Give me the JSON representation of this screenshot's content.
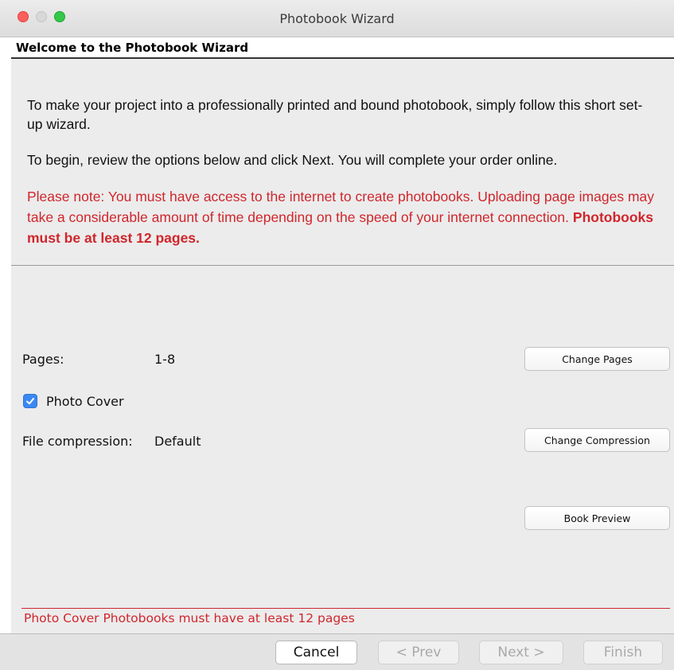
{
  "window": {
    "title": "Photobook Wizard"
  },
  "header": {
    "title": "Welcome to the Photobook Wizard"
  },
  "intro": {
    "paragraph1": "To make your project into a professionally printed and bound photobook, simply follow this short set-up wizard.",
    "paragraph2": "To begin, review the options below and click Next. You will complete your order online.",
    "note": "Please note: You must have access to the internet to create photobooks. Uploading page images may take a considerable amount of time depending on the speed of your internet connection.",
    "note_bold": "Photobooks must be at least 12 pages."
  },
  "options": {
    "pages_label": "Pages:",
    "pages_value": "1-8",
    "change_pages_button": "Change Pages",
    "photo_cover_label": "Photo Cover",
    "photo_cover_checked": true,
    "compression_label": "File compression:",
    "compression_value": "Default",
    "change_compression_button": "Change Compression",
    "book_preview_button": "Book Preview"
  },
  "warning": {
    "text": "Photo Cover Photobooks must have at least 12 pages"
  },
  "navigation": {
    "cancel": "Cancel",
    "prev": "< Prev",
    "next": "Next >",
    "finish": "Finish"
  },
  "colors": {
    "warning_red": "#d0262c",
    "checkbox_blue": "#3b88f2",
    "close": "#fc605c",
    "maximize": "#34c84a"
  }
}
